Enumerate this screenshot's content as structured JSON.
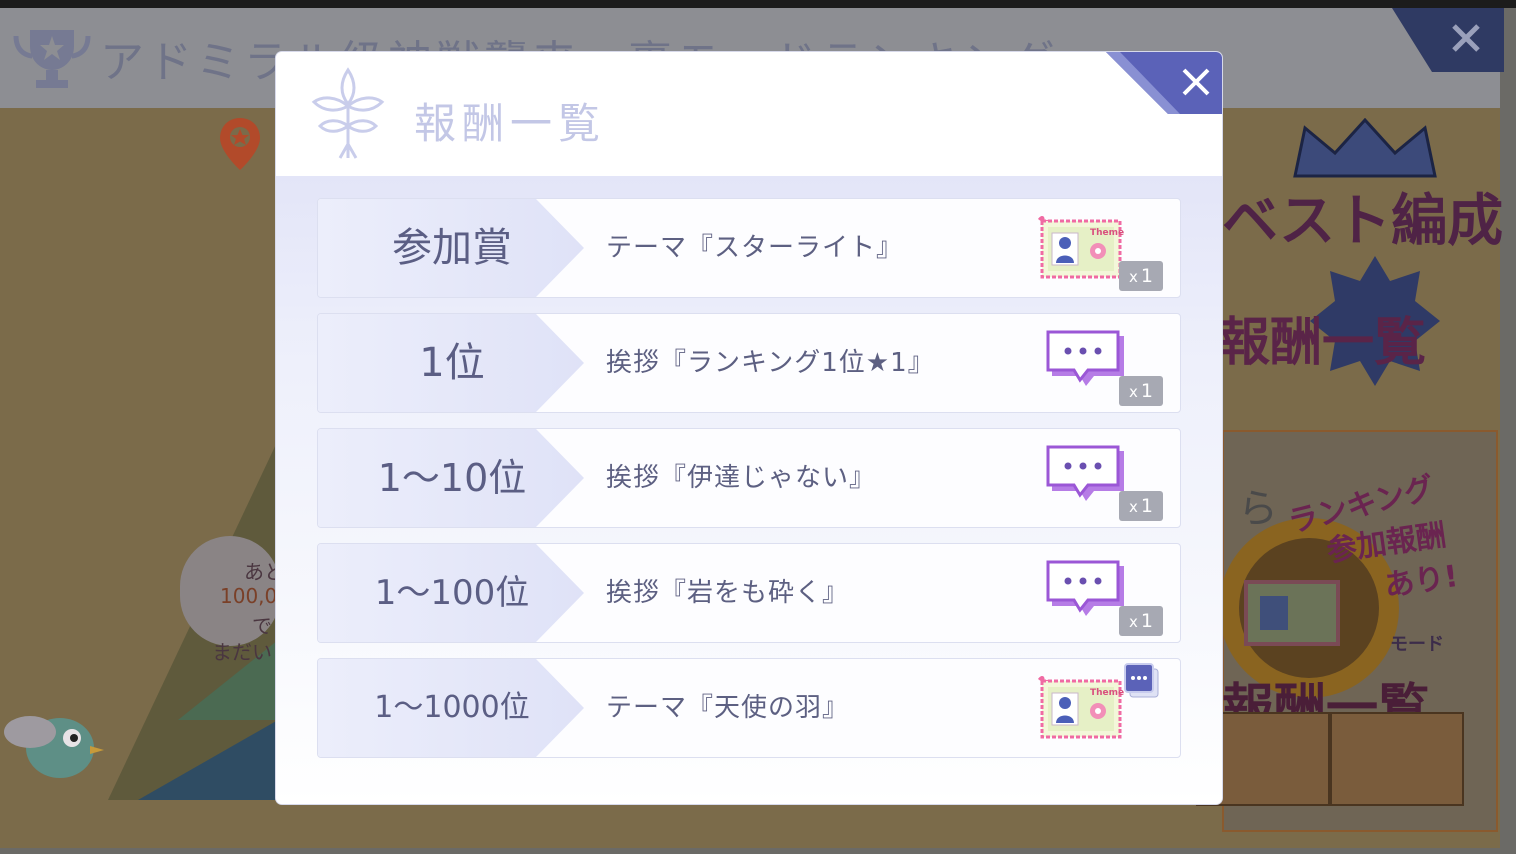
{
  "background": {
    "event_title": "アドミラル級神獣襲来　裏モードランキング",
    "badges": [
      {
        "label": "ベスト編成"
      },
      {
        "label": "報酬一覧"
      },
      {
        "label": "報酬一覧"
      }
    ],
    "promo": {
      "line1": "ランキング",
      "line2": "参加報酬",
      "line3": "あり!",
      "mode_label": "モード"
    },
    "partial_text": "ら",
    "cloud_text": [
      "あと",
      "100,0",
      "で",
      "まだい"
    ]
  },
  "modal": {
    "title": "報酬一覧",
    "rows": [
      {
        "rank": "参加賞",
        "reward": "テーマ『スターライト』",
        "item": "theme-card",
        "quantity": "1"
      },
      {
        "rank": "1位",
        "reward": "挨拶『ランキング1位★1』",
        "item": "chat-bubble",
        "quantity": "1"
      },
      {
        "rank": "1～10位",
        "reward": "挨拶『伊達じゃない』",
        "item": "chat-bubble",
        "quantity": "1"
      },
      {
        "rank": "1～100位",
        "reward": "挨拶『岩をも砕く』",
        "item": "chat-bubble",
        "quantity": "1"
      },
      {
        "rank": "1～1000位",
        "reward": "テーマ『天使の羽』",
        "item": "theme-card",
        "quantity": ""
      }
    ],
    "theme_card_label": "Theme",
    "quantity_prefix": "x"
  },
  "colors": {
    "accent": "#5b62b8",
    "title_text": "#c3c7e6",
    "row_text": "#5d6082",
    "chat_purple": "#9b57d6",
    "theme_pink": "#f06aa3"
  }
}
